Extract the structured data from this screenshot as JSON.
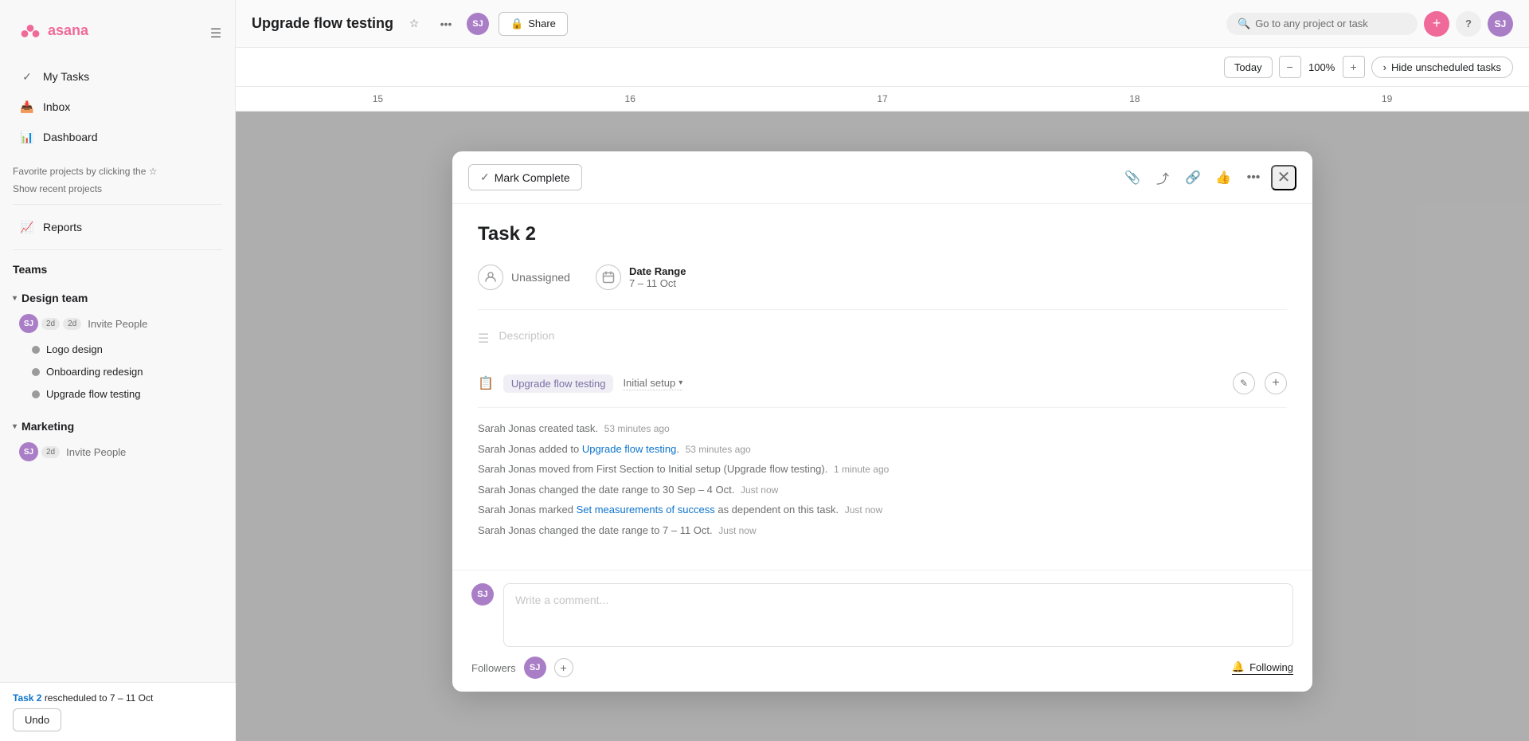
{
  "app": {
    "logo_text": "asana"
  },
  "sidebar": {
    "nav_items": [
      {
        "id": "my-tasks",
        "label": "My Tasks"
      },
      {
        "id": "inbox",
        "label": "Inbox"
      },
      {
        "id": "dashboard",
        "label": "Dashboard"
      }
    ],
    "favorites_label": "Favorite projects by clicking the ☆",
    "show_recent": "Show recent projects",
    "reports_label": "Reports",
    "teams_label": "Teams",
    "teams": [
      {
        "id": "design-team",
        "name": "Design team",
        "members": [
          "SJ",
          "2d",
          "2d"
        ],
        "invite_label": "Invite People",
        "projects": [
          {
            "id": "logo-design",
            "label": "Logo design",
            "color": "#aaa"
          },
          {
            "id": "onboarding-redesign",
            "label": "Onboarding redesign",
            "color": "#aaa"
          },
          {
            "id": "upgrade-flow-testing",
            "label": "Upgrade flow testing",
            "color": "#aaa"
          }
        ]
      },
      {
        "id": "marketing",
        "name": "Marketing",
        "members": [
          "SJ",
          "2d"
        ],
        "invite_label": "Invite People",
        "projects": []
      }
    ]
  },
  "notification": {
    "text": "Task 2 rescheduled to 7 – 11 Oct",
    "task_link": "Task 2",
    "undo_label": "Undo"
  },
  "topbar": {
    "project_title": "Upgrade flow testing",
    "share_label": "Share",
    "search_placeholder": "Go to any project or task"
  },
  "timeline_controls": {
    "today_label": "Today",
    "zoom_minus": "−",
    "zoom_value": "100%",
    "zoom_plus": "+",
    "hide_tasks_label": "Hide unscheduled tasks"
  },
  "timeline_dates": [
    "15",
    "16",
    "17",
    "18",
    "19"
  ],
  "modal": {
    "mark_complete_label": "Mark Complete",
    "task_title": "Task 2",
    "unassigned_label": "Unassigned",
    "date_range_label": "Date Range",
    "date_range_value": "7 – 11 Oct",
    "description_placeholder": "Description",
    "project_tag": "Upgrade flow testing",
    "section_tag": "Initial setup",
    "activity": [
      {
        "text": "Sarah Jonas created task.",
        "time": "53 minutes ago"
      },
      {
        "text": "Sarah Jonas added to",
        "link": "Upgrade flow testing",
        "time": "53 minutes ago"
      },
      {
        "text": "Sarah Jonas moved from First Section to Initial setup (Upgrade flow testing).",
        "time": "1 minute ago"
      },
      {
        "text": "Sarah Jonas changed the date range to 30 Sep – 4 Oct.",
        "time": "Just now"
      },
      {
        "text": "Sarah Jonas marked",
        "link": "Set measurements of success",
        "after": "as dependent on this task.",
        "time": "Just now"
      },
      {
        "text": "Sarah Jonas changed the date range to 7 – 11 Oct.",
        "time": "Just now"
      }
    ],
    "comment_placeholder": "Write a comment...",
    "followers_label": "Followers",
    "following_label": "Following"
  },
  "colors": {
    "accent_purple": "#aa7ec7",
    "accent_pink": "#f06a99",
    "accent_teal": "#37c5ab",
    "link_blue": "#0d74cc",
    "project_tag_bg": "#f0eff5",
    "project_tag_text": "#7c6fa4"
  }
}
